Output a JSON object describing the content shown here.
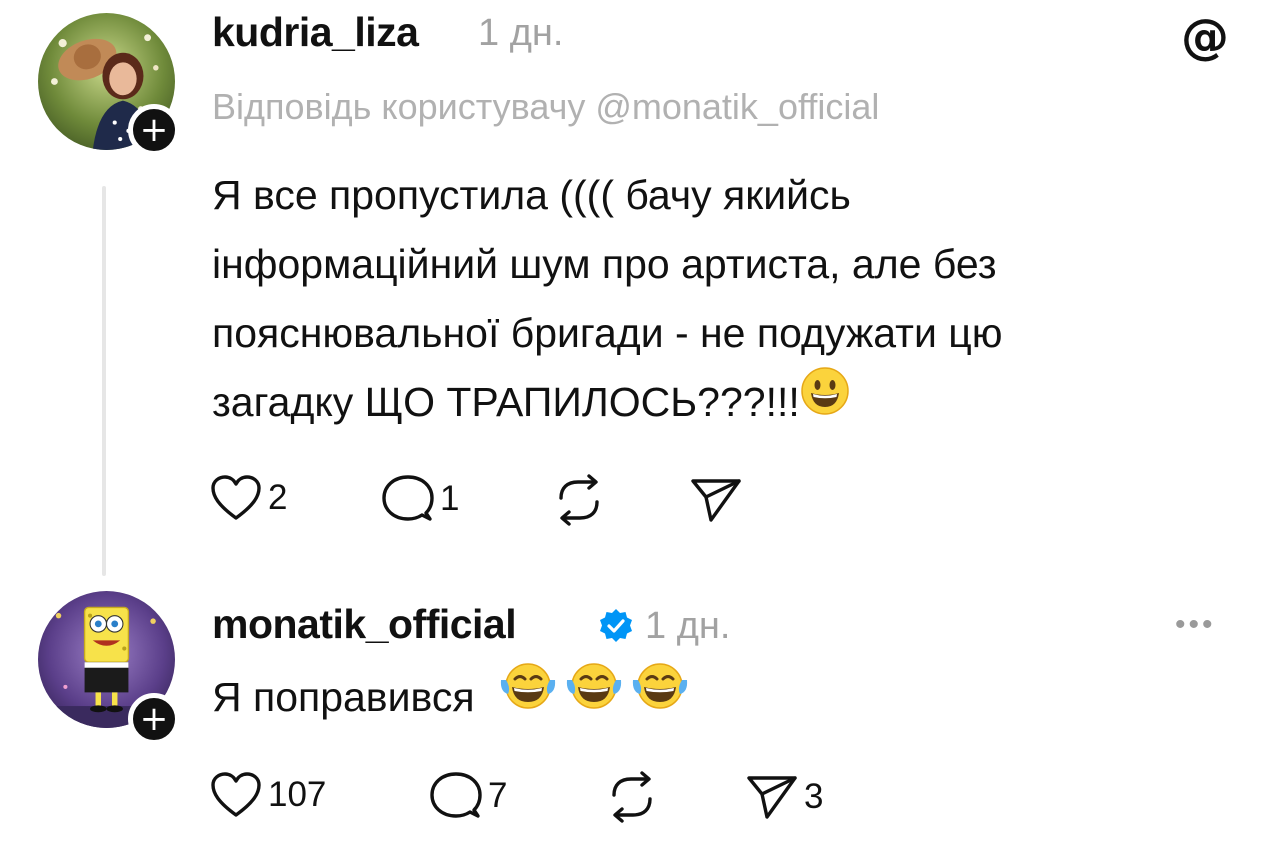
{
  "post1": {
    "username": "kudria_liza",
    "time": "1 дн.",
    "reply_to": "Відповідь користувачу @monatik_official",
    "lines": [
      "Я все пропустила (((( бачу якийсь",
      "інформаційний шум про артиста, але без",
      "пояснювальної бригади - не подужати цю",
      "загадку ЩО ТРАПИЛОСЬ???!!!"
    ],
    "emoji": "grinning-face",
    "likes": "2",
    "replies": "1"
  },
  "post2": {
    "username": "monatik_official",
    "time": "1 дн.",
    "text": "Я поправився",
    "emoji": "face-with-tears-of-joy",
    "likes": "107",
    "replies": "7",
    "shares": "3"
  },
  "icons": {
    "app": "threads-logo-icon",
    "like": "heart-icon",
    "reply": "comment-icon",
    "repost": "repost-icon",
    "share": "send-icon",
    "more": "more-icon",
    "verified": "verified-badge-icon",
    "follow": "plus-icon"
  },
  "colors": {
    "verified": "#0095f6",
    "muted": "#a2a2a2"
  }
}
